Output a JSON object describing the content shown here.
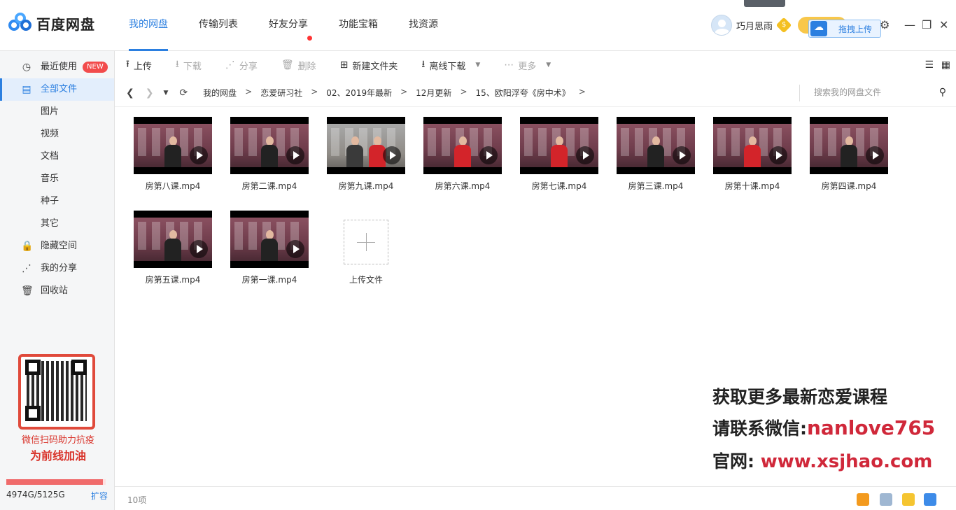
{
  "app": {
    "name": "百度网盘"
  },
  "top_nav": [
    {
      "label": "我的网盘",
      "active": true
    },
    {
      "label": "传输列表"
    },
    {
      "label": "好友分享",
      "dot": true
    },
    {
      "label": "功能宝箱"
    },
    {
      "label": "找资源"
    }
  ],
  "user": {
    "name": "巧月思雨",
    "coin_symbol": "$"
  },
  "drag_upload": {
    "label": "拖拽上传"
  },
  "window_controls": {
    "settings": "⚙",
    "minimize": "—",
    "restore": "❐",
    "close": "✕"
  },
  "sidebar": {
    "items": [
      {
        "label": "最近使用",
        "icon": "clock-icon",
        "glyph": "◷",
        "badge": "NEW"
      },
      {
        "label": "全部文件",
        "icon": "document-icon",
        "glyph": "▤",
        "active": true
      },
      {
        "label": "图片",
        "sub": true
      },
      {
        "label": "视频",
        "sub": true
      },
      {
        "label": "文档",
        "sub": true
      },
      {
        "label": "音乐",
        "sub": true
      },
      {
        "label": "种子",
        "sub": true
      },
      {
        "label": "其它",
        "sub": true
      },
      {
        "label": "隐藏空间",
        "icon": "lock-icon",
        "glyph": "🔒"
      },
      {
        "label": "我的分享",
        "icon": "share-icon",
        "glyph": "⋰"
      },
      {
        "label": "回收站",
        "icon": "trash-icon",
        "glyph": "🗑"
      }
    ],
    "promo": {
      "line1": "微信扫码助力抗疫",
      "line2": "为前线加油"
    },
    "quota": {
      "text": "4974G/5125G",
      "used_fraction": 0.97,
      "expand_label": "扩容"
    }
  },
  "toolbar": {
    "upload": "上传",
    "download": "下载",
    "share": "分享",
    "delete": "删除",
    "new_folder": "新建文件夹",
    "offline_download": "离线下载",
    "more": "更多"
  },
  "breadcrumb": {
    "items": [
      "我的网盘",
      "恋爱研习社",
      "02、2019年最新",
      "12月更新",
      "15、欧阳浮夸《房中术》"
    ],
    "trailing_sep": ">"
  },
  "search": {
    "placeholder": "搜索我的网盘文件"
  },
  "files": [
    {
      "name": "房第八课.mp4",
      "style": "dark"
    },
    {
      "name": "房第二课.mp4",
      "style": "dark"
    },
    {
      "name": "房第九课.mp4",
      "style": "grey"
    },
    {
      "name": "房第六课.mp4",
      "style": "red"
    },
    {
      "name": "房第七课.mp4",
      "style": "red"
    },
    {
      "name": "房第三课.mp4",
      "style": "dark"
    },
    {
      "name": "房第十课.mp4",
      "style": "red"
    },
    {
      "name": "房第四课.mp4",
      "style": "dark"
    },
    {
      "name": "房第五课.mp4",
      "style": "dark"
    },
    {
      "name": "房第一课.mp4",
      "style": "dark"
    }
  ],
  "upload_tile": {
    "label": "上传文件"
  },
  "watermark": {
    "line1": "获取更多最新恋爱课程",
    "line2_prefix": "请联系微信:",
    "line2_value": "nanlove765",
    "line3_prefix": "官网:",
    "line3_value": "www.xsjhao.com"
  },
  "status": {
    "count": "10项"
  },
  "colors": {
    "accent": "#2b7fe0",
    "danger": "#d0283a"
  }
}
